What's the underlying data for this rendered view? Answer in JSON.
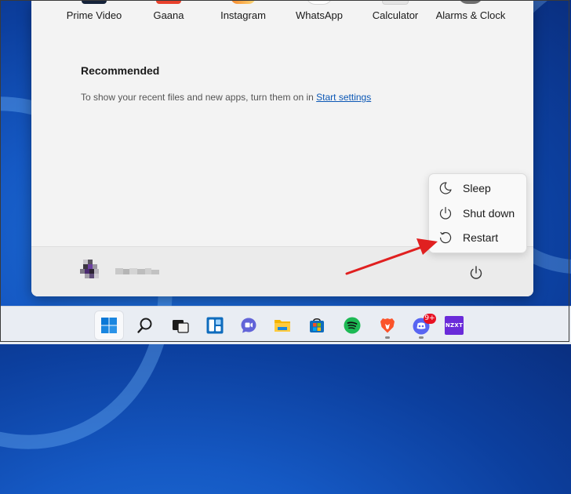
{
  "pinned_apps": [
    {
      "label": "Prime Video",
      "icon": "prime-video-icon",
      "color": "#1a1a2e"
    },
    {
      "label": "Gaana",
      "icon": "gaana-icon",
      "color": "#e8412c"
    },
    {
      "label": "Instagram",
      "icon": "instagram-icon",
      "color": "#f58529"
    },
    {
      "label": "WhatsApp",
      "icon": "whatsapp-icon",
      "color": "#ffffff"
    },
    {
      "label": "Calculator",
      "icon": "calculator-icon",
      "color": "#e4e4e4"
    },
    {
      "label": "Alarms & Clock",
      "icon": "alarm-clock-icon",
      "color": "#6e6e6e"
    }
  ],
  "recommended": {
    "title": "Recommended",
    "text": "To show your recent files and new apps, turn them on in ",
    "link": "Start settings"
  },
  "power_menu": {
    "items": [
      {
        "label": "Sleep",
        "icon": "sleep-icon"
      },
      {
        "label": "Shut down",
        "icon": "shutdown-icon"
      },
      {
        "label": "Restart",
        "icon": "restart-icon"
      }
    ]
  },
  "annotation": {
    "color": "#e02020",
    "target": "Restart"
  },
  "taskbar": {
    "items": [
      {
        "name": "start-button",
        "icon": "windows-logo-icon"
      },
      {
        "name": "search-button",
        "icon": "search-icon"
      },
      {
        "name": "task-view-button",
        "icon": "task-view-icon"
      },
      {
        "name": "widgets-button",
        "icon": "widgets-icon"
      },
      {
        "name": "teams-chat-button",
        "icon": "teams-chat-icon"
      },
      {
        "name": "file-explorer-button",
        "icon": "folder-icon"
      },
      {
        "name": "microsoft-store-button",
        "icon": "store-icon"
      },
      {
        "name": "spotify-button",
        "icon": "spotify-icon"
      },
      {
        "name": "brave-button",
        "icon": "brave-icon"
      },
      {
        "name": "discord-button",
        "icon": "discord-icon",
        "badge": "9+"
      },
      {
        "name": "nzxt-cam-button",
        "icon": "nzxt-icon",
        "label": "NZXT"
      }
    ]
  }
}
